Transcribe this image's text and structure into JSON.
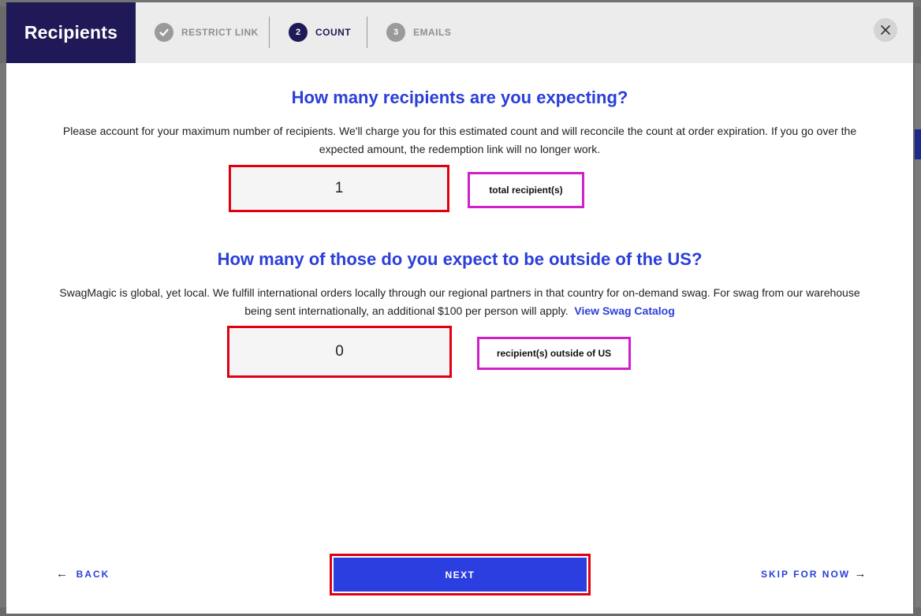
{
  "modal": {
    "title": "Recipients",
    "steps": [
      {
        "number": "✓",
        "label": "RESTRICT LINK",
        "state": "done"
      },
      {
        "number": "2",
        "label": "COUNT",
        "state": "active"
      },
      {
        "number": "3",
        "label": "EMAILS",
        "state": "pending"
      }
    ],
    "close_icon": "close-icon"
  },
  "count_section": {
    "title": "How many recipients are you expecting?",
    "description": "Please account for your maximum number of recipients. We'll charge you for this estimated count and will reconcile the count at order expiration. If you go over the expected amount, the redemption link will no longer work.",
    "value": "1",
    "unit_label": "total recipient(s)"
  },
  "international_section": {
    "title": "How many of those do you expect to be outside of the US?",
    "description": "SwagMagic is global, yet local. We fulfill international orders locally through our regional partners in that country for on-demand swag. For swag from our warehouse being sent internationally, an additional $100 per person will apply.",
    "catalog_link": "View Swag Catalog",
    "value": "0",
    "unit_label": "recipient(s) outside of US"
  },
  "footer": {
    "back_label": "BACK",
    "next_label": "NEXT",
    "skip_label": "SKIP FOR NOW"
  },
  "colors": {
    "brand_dark": "#1f1a57",
    "accent_blue": "#2b3ed8",
    "highlight_red": "#e00010",
    "highlight_magenta": "#d020c8"
  }
}
